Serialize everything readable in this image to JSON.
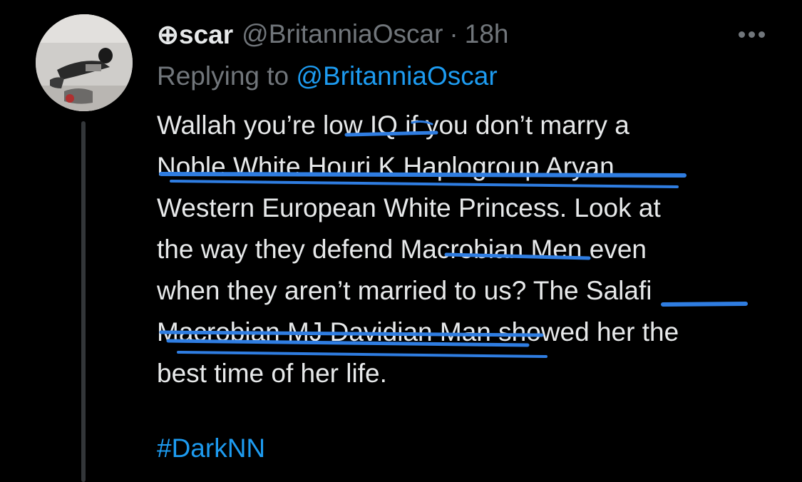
{
  "tweet": {
    "display_name": "⊕scar",
    "handle": "@BritanniaOscar",
    "separator": "·",
    "time": "18h",
    "more_icon": "more-horizontal-icon",
    "replying_prefix": "Replying to",
    "replying_handle": "@BritanniaOscar",
    "body_lines": [
      "Wallah you’re low IQ if you don’t marry a",
      "Noble White Houri K Haplogroup Aryan",
      "Western European White Princess. Look at",
      "the way they defend Macrobian Men even",
      "when they aren’t married to us? The Salafi",
      "Macrobian MJ Davidian Man showed her the",
      "best time of her life."
    ],
    "hashtag": "#DarkNN"
  },
  "colors": {
    "background": "#000000",
    "text": "#e7e9ea",
    "muted": "#71767b",
    "link": "#1d9bf0",
    "annotation": "#2f7de1"
  }
}
